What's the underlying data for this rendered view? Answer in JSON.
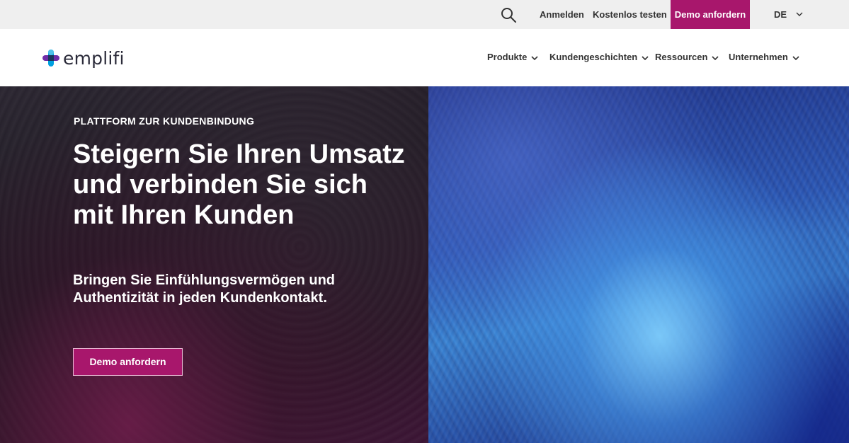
{
  "utility_bar": {
    "search_icon": "search-icon",
    "login": "Anmelden",
    "trial": "Kostenlos testen",
    "demo": "Demo anfordern",
    "language": "DE",
    "language_icon": "chevron-down-icon"
  },
  "brand": {
    "name": "emplifi",
    "accent_color": "#a8176c",
    "logo_colors": [
      "#00a0e0",
      "#6f2da8",
      "#1b365d",
      "#4fc1e9"
    ]
  },
  "nav": {
    "items": [
      {
        "label": "Produkte",
        "icon": "chevron-down-icon"
      },
      {
        "label": "Kundengeschichten",
        "icon": "chevron-down-icon"
      },
      {
        "label": "Ressourcen",
        "icon": "chevron-down-icon"
      },
      {
        "label": "Unternehmen",
        "icon": "chevron-down-icon"
      }
    ]
  },
  "hero": {
    "eyebrow": "PLATTFORM ZUR KUNDENBINDUNG",
    "headline": "Steigern Sie Ihren Umsatz und verbinden Sie sich mit Ihren Kunden",
    "subline": "Bringen Sie Einfühlungsvermögen und Authentizität in jeden Kundenkontakt.",
    "cta": "Demo anfordern"
  }
}
